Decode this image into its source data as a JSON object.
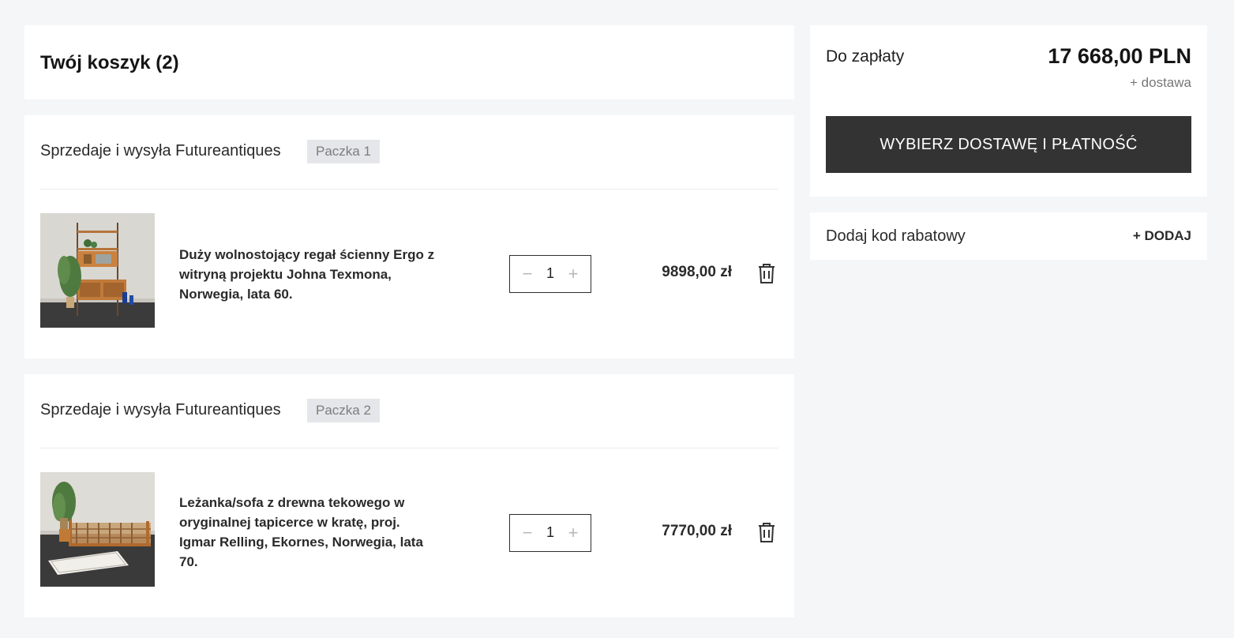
{
  "cart": {
    "title": "Twój koszyk (2)"
  },
  "packages": [
    {
      "seller": "Sprzedaje i wysyła Futureantiques",
      "badge": "Paczka 1",
      "item": {
        "name": "Duży wolnostojący regał ścienny Ergo z witryną projektu Johna Texmona, Norwegia, lata 60.",
        "quantity": "1",
        "price": "9898,00 zł",
        "image": "wall-shelf-product-photo"
      }
    },
    {
      "seller": "Sprzedaje i wysyła Futureantiques",
      "badge": "Paczka 2",
      "item": {
        "name": "Leżanka/sofa z drewna tekowego w oryginalnej tapicerce w kratę, proj. Igmar Relling, Ekornes, Norwegia, lata 70.",
        "quantity": "1",
        "price": "7770,00 zł",
        "image": "daybed-sofa-product-photo"
      }
    }
  ],
  "qty_controls": {
    "minus": "−",
    "plus": "+"
  },
  "icons": {
    "remove": "trash-icon",
    "decrease": "minus-icon",
    "increase": "plus-icon"
  },
  "summary": {
    "label": "Do zapłaty",
    "total": "17 668,00 PLN",
    "shipping_note": "+ dostawa",
    "checkout_button": "WYBIERZ DOSTAWĘ I PŁATNOŚĆ"
  },
  "discount": {
    "label": "Dodaj kod rabatowy",
    "add": "+ DODAJ"
  },
  "colors": {
    "background": "#f5f6f8",
    "panel": "#ffffff",
    "button": "#333333",
    "badge": "#e5e6e9"
  }
}
